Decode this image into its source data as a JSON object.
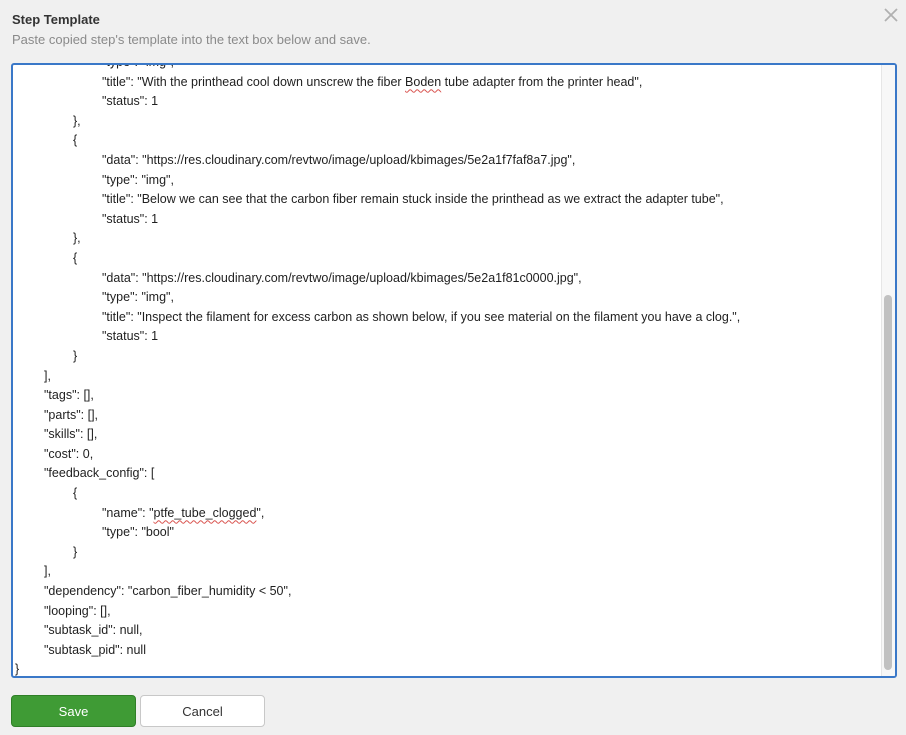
{
  "dialog": {
    "title": "Step Template",
    "subtitle": "Paste copied step's template into the text box below and save."
  },
  "editor": {
    "lines": [
      {
        "indent": 3,
        "text": "\"type\": \"img\","
      },
      {
        "indent": 3,
        "text": "\"title\": \"With the printhead cool down unscrew the fiber Boden tube adapter from the printer head\","
      },
      {
        "indent": 3,
        "text": "\"status\": 1"
      },
      {
        "indent": 2,
        "text": "},"
      },
      {
        "indent": 2,
        "text": "{"
      },
      {
        "indent": 3,
        "text": "\"data\": \"https://res.cloudinary.com/revtwo/image/upload/kbimages/5e2a1f7faf8a7.jpg\","
      },
      {
        "indent": 3,
        "text": "\"type\": \"img\","
      },
      {
        "indent": 3,
        "text": "\"title\": \"Below we can see that the carbon fiber remain stuck inside the printhead as we extract the adapter tube\","
      },
      {
        "indent": 3,
        "text": "\"status\": 1"
      },
      {
        "indent": 2,
        "text": "},"
      },
      {
        "indent": 2,
        "text": "{"
      },
      {
        "indent": 3,
        "text": "\"data\": \"https://res.cloudinary.com/revtwo/image/upload/kbimages/5e2a1f81c0000.jpg\","
      },
      {
        "indent": 3,
        "text": "\"type\": \"img\","
      },
      {
        "indent": 3,
        "text": "\"title\": \"Inspect the filament for excess carbon as shown below, if you see material on the filament you have a clog.\","
      },
      {
        "indent": 3,
        "text": "\"status\": 1"
      },
      {
        "indent": 2,
        "text": "}"
      },
      {
        "indent": 1,
        "text": "],"
      },
      {
        "indent": 1,
        "text": "\"tags\": [],"
      },
      {
        "indent": 1,
        "text": "\"parts\": [],"
      },
      {
        "indent": 1,
        "text": "\"skills\": [],"
      },
      {
        "indent": 1,
        "text": "\"cost\": 0,"
      },
      {
        "indent": 1,
        "text": "\"feedback_config\": ["
      },
      {
        "indent": 2,
        "text": "{"
      },
      {
        "indent": 3,
        "text": "\"name\": \"ptfe_tube_clogged\","
      },
      {
        "indent": 3,
        "text": "\"type\": \"bool\""
      },
      {
        "indent": 2,
        "text": "}"
      },
      {
        "indent": 1,
        "text": "],"
      },
      {
        "indent": 1,
        "text": "\"dependency\": \"carbon_fiber_humidity < 50\","
      },
      {
        "indent": 1,
        "text": "\"looping\": [],"
      },
      {
        "indent": 1,
        "text": "\"subtask_id\": null,"
      },
      {
        "indent": 1,
        "text": "\"subtask_pid\": null"
      },
      {
        "indent": 0,
        "text": "}"
      }
    ],
    "spellcheck_words": [
      "Boden",
      "ptfe_tube_clogged"
    ]
  },
  "buttons": {
    "save_label": "Save",
    "cancel_label": "Cancel"
  },
  "icons": {
    "close": "close-icon"
  },
  "colors": {
    "accent": "#3a78c8",
    "save": "#3f9b35",
    "spellcheck": "#d9534f"
  }
}
